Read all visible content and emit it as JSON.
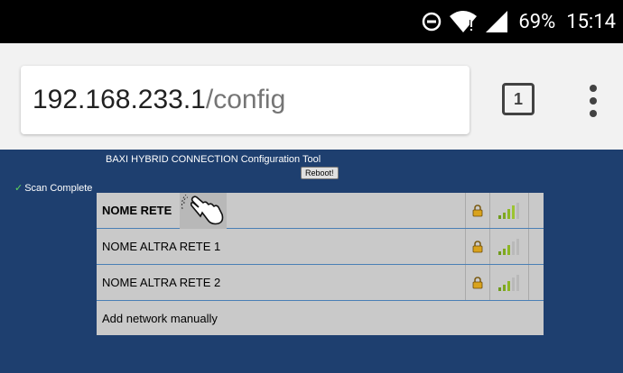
{
  "status_bar": {
    "battery_percent": "69%",
    "time": "15:14",
    "icons": [
      "data-saver-icon",
      "wifi-alert-icon",
      "cell-signal-icon"
    ]
  },
  "browser": {
    "url_host": "192.168.233.1",
    "url_path": "/config",
    "tab_count": "1",
    "menu_icon": "more-vert-icon"
  },
  "page": {
    "title": "BAXI HYBRID CONNECTION Configuration Tool",
    "reboot_label": "Reboot!",
    "scan_status": "Scan Complete",
    "background_color": "#1e3f6f"
  },
  "networks": [
    {
      "name": "NOME RETE",
      "selected": true,
      "secured": true
    },
    {
      "name": "NOME ALTRA RETE 1",
      "selected": false,
      "secured": true
    },
    {
      "name": "NOME ALTRA RETE 2",
      "selected": false,
      "secured": true
    },
    {
      "name": "Add network manually",
      "selected": false,
      "secured": false
    }
  ]
}
